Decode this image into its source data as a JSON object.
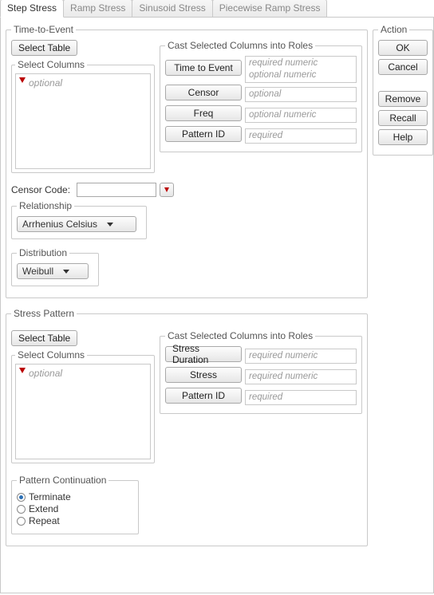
{
  "tabs": {
    "step": "Step Stress",
    "ramp": "Ramp Stress",
    "sinusoid": "Sinusoid Stress",
    "piecewise": "Piecewise Ramp Stress"
  },
  "tte": {
    "legend": "Time-to-Event",
    "select_table": "Select Table",
    "select_columns_legend": "Select Columns",
    "optional_ph": "optional",
    "roles_legend": "Cast Selected Columns into Roles",
    "time_to_event_btn": "Time to Event",
    "time_to_event_slot": "required numeric\noptional numeric",
    "censor_btn": "Censor",
    "censor_slot": "optional",
    "freq_btn": "Freq",
    "freq_slot": "optional numeric",
    "pattern_id_btn": "Pattern ID",
    "pattern_id_slot": "required",
    "censor_code_label": "Censor Code:",
    "relationship_legend": "Relationship",
    "relationship_value": "Arrhenius Celsius",
    "distribution_legend": "Distribution",
    "distribution_value": "Weibull"
  },
  "sp": {
    "legend": "Stress Pattern",
    "select_table": "Select Table",
    "select_columns_legend": "Select Columns",
    "optional_ph": "optional",
    "roles_legend": "Cast Selected Columns into Roles",
    "stress_duration_btn": "Stress Duration",
    "stress_duration_slot": "required numeric",
    "stress_btn": "Stress",
    "stress_slot": "required numeric",
    "pattern_id_btn": "Pattern ID",
    "pattern_id_slot": "required",
    "continuation_legend": "Pattern Continuation",
    "terminate": "Terminate",
    "extend": "Extend",
    "repeat": "Repeat"
  },
  "action": {
    "legend": "Action",
    "ok": "OK",
    "cancel": "Cancel",
    "remove": "Remove",
    "recall": "Recall",
    "help": "Help"
  }
}
